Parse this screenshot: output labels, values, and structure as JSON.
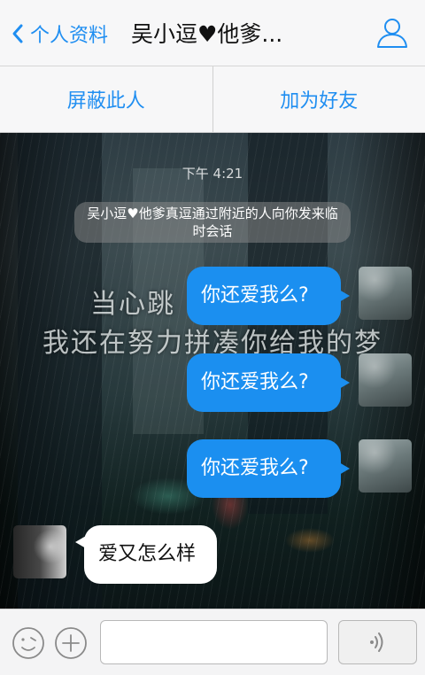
{
  "header": {
    "back_label": "个人资料",
    "title": "吴小逗♥他爹...",
    "back_icon": "chevron-left-icon",
    "profile_icon": "person-outline-icon"
  },
  "actions": {
    "block_label": "屏蔽此人",
    "add_friend_label": "加为好友"
  },
  "chat": {
    "timestamp": "下午 4:21",
    "system_notice": "吴小逗♥他爹真逗通过附近的人向你发来临时会话",
    "wallpaper_text": [
      "当心跳",
      "我还在努力拼凑你给我的梦"
    ],
    "messages": [
      {
        "sender": "me",
        "text": "你还爱我么?"
      },
      {
        "sender": "me",
        "text": "你还爱我么?"
      },
      {
        "sender": "me",
        "text": "你还爱我么?"
      },
      {
        "sender": "other",
        "text": "爱又怎么样"
      }
    ]
  },
  "input_bar": {
    "emoji_icon": "smiley-icon",
    "plus_icon": "plus-circle-icon",
    "text_value": "",
    "voice_icon": "voice-wave-icon"
  },
  "colors": {
    "accent": "#1F8EF1",
    "outgoing_bubble": "#1B8FF0",
    "incoming_bubble": "#FFFFFF"
  }
}
